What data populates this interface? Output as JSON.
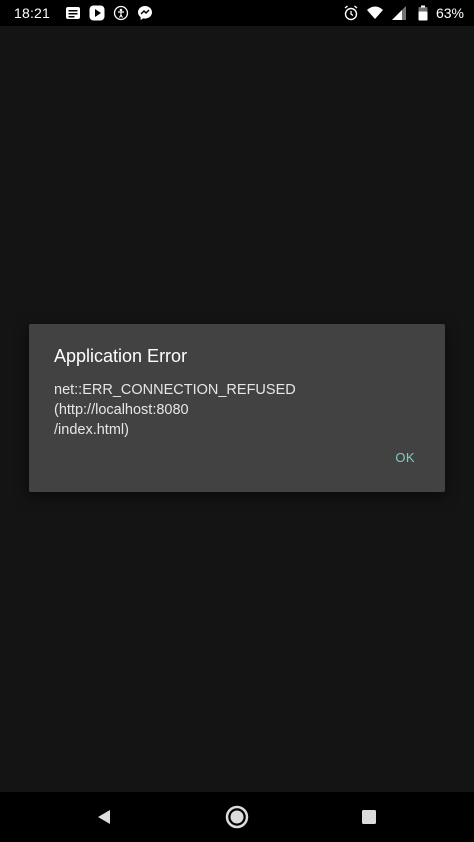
{
  "status_bar": {
    "time": "18:21",
    "battery": "63%",
    "left_icons": [
      "notes-icon",
      "play-icon",
      "accessibility-icon",
      "messenger-icon"
    ],
    "right_icons": [
      "alarm-icon",
      "wifi-icon",
      "signal-icon",
      "battery-icon"
    ]
  },
  "dialog": {
    "title": "Application Error",
    "message": "net::ERR_CONNECTION_REFUSED (http://localhost:8080\n/index.html)",
    "ok_label": "OK",
    "accent_color": "#80cbc4"
  },
  "nav_bar": {
    "buttons": [
      "back",
      "home",
      "recents"
    ]
  }
}
